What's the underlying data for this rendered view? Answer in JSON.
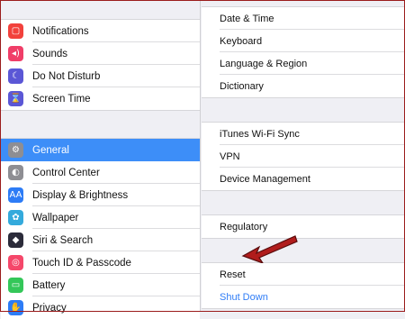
{
  "sidebar": {
    "group1": [
      {
        "label": "Notifications",
        "icon": "notifications-icon",
        "color": "#f2413c",
        "glyph": "▢"
      },
      {
        "label": "Sounds",
        "icon": "sounds-icon",
        "color": "#f03e68",
        "glyph": "◂)"
      },
      {
        "label": "Do Not Disturb",
        "icon": "moon-icon",
        "color": "#5b57d6",
        "glyph": "☾"
      },
      {
        "label": "Screen Time",
        "icon": "hourglass-icon",
        "color": "#5b57d6",
        "glyph": "⌛"
      }
    ],
    "group2": [
      {
        "label": "General",
        "icon": "gear-icon",
        "color": "#8e8e93",
        "glyph": "⚙",
        "selected": true
      },
      {
        "label": "Control Center",
        "icon": "control-center-icon",
        "color": "#8e8e93",
        "glyph": "◐"
      },
      {
        "label": "Display & Brightness",
        "icon": "display-brightness-icon",
        "color": "#2d7cf6",
        "glyph": "AA"
      },
      {
        "label": "Wallpaper",
        "icon": "wallpaper-icon",
        "color": "#34aadc",
        "glyph": "✿"
      },
      {
        "label": "Siri & Search",
        "icon": "siri-icon",
        "color": "#2b2b3a",
        "glyph": "◆"
      },
      {
        "label": "Touch ID & Passcode",
        "icon": "fingerprint-icon",
        "color": "#f5476a",
        "glyph": "◎"
      },
      {
        "label": "Battery",
        "icon": "battery-icon",
        "color": "#34c759",
        "glyph": "▭"
      },
      {
        "label": "Privacy",
        "icon": "hand-icon",
        "color": "#2d7cf6",
        "glyph": "✋"
      }
    ]
  },
  "detail": {
    "section1": [
      "Date & Time",
      "Keyboard",
      "Language & Region",
      "Dictionary"
    ],
    "section2": [
      "iTunes Wi-Fi Sync",
      "VPN",
      "Device Management"
    ],
    "section3": [
      "Regulatory"
    ],
    "section4": {
      "reset": "Reset",
      "shutdown": "Shut Down"
    }
  },
  "colors": {
    "accent": "#3d8ef8",
    "link": "#2f7cf6",
    "arrow": "#b01c1c"
  }
}
